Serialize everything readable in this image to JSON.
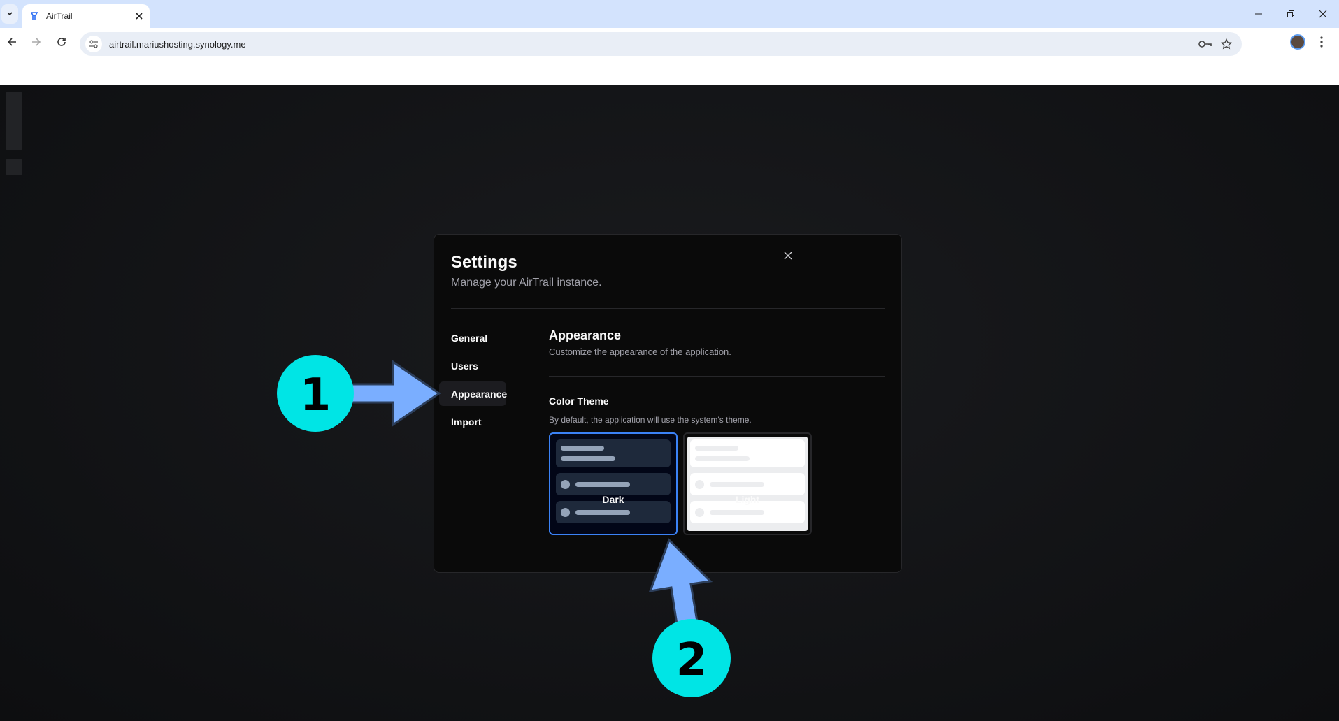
{
  "browser": {
    "tab_title": "AirTrail",
    "url": "airtrail.mariushosting.synology.me"
  },
  "settings": {
    "title": "Settings",
    "subtitle": "Manage your AirTrail instance.",
    "nav": [
      {
        "label": "General",
        "active": false
      },
      {
        "label": "Users",
        "active": false
      },
      {
        "label": "Appearance",
        "active": true
      },
      {
        "label": "Import",
        "active": false
      }
    ],
    "section": {
      "heading": "Appearance",
      "description": "Customize the appearance of the application."
    },
    "color_theme": {
      "label": "Color Theme",
      "description": "By default, the application will use the system's theme.",
      "options": [
        {
          "label": "Dark",
          "selected": true
        },
        {
          "label": "Light",
          "selected": false
        }
      ]
    }
  },
  "annotations": [
    {
      "label": "1"
    },
    {
      "label": "2"
    }
  ],
  "colors": {
    "accent": "#3b82f6",
    "annotation_circle": "#00e5e5",
    "annotation_arrow": "#7aaeff"
  }
}
